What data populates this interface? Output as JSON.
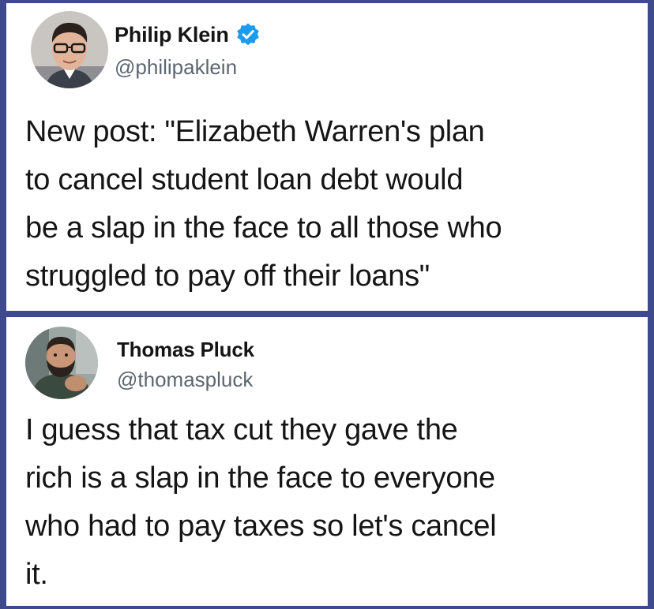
{
  "tweets": [
    {
      "display_name": "Philip Klein",
      "handle": "@philipaklein",
      "verified": true,
      "avatar_icon": "person-with-glasses-avatar",
      "text": "New post: \"Elizabeth Warren's plan\nto cancel student loan debt would\nbe a slap in the face to all those who\nstruggled to pay off their loans\""
    },
    {
      "display_name": "Thomas Pluck",
      "handle": "@thomaspluck",
      "verified": false,
      "avatar_icon": "bearded-person-avatar",
      "text": "I guess that tax cut they gave the\nrich is a slap in the face to everyone\nwho had to pay taxes so let's cancel\nit."
    }
  ],
  "colors": {
    "background": "#3f4a8c",
    "card": "#ffffff",
    "verified": "#1d9bf0",
    "handle": "#5c6670",
    "text": "#151515"
  }
}
